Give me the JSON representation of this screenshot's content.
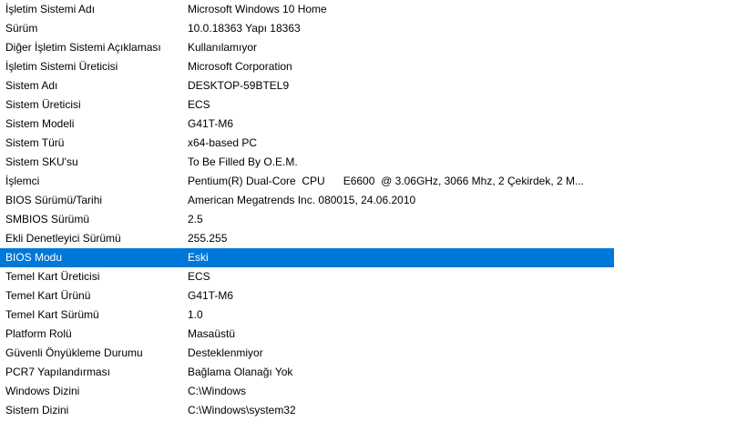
{
  "system_summary": {
    "rows": [
      {
        "item": "İşletim Sistemi Adı",
        "value": "Microsoft Windows 10 Home"
      },
      {
        "item": "Sürüm",
        "value": "10.0.18363 Yapı 18363"
      },
      {
        "item": "Diğer İşletim Sistemi Açıklaması",
        "value": "Kullanılamıyor"
      },
      {
        "item": "İşletim Sistemi Üreticisi",
        "value": "Microsoft Corporation"
      },
      {
        "item": "Sistem Adı",
        "value": "DESKTOP-59BTEL9"
      },
      {
        "item": "Sistem Üreticisi",
        "value": "ECS"
      },
      {
        "item": "Sistem Modeli",
        "value": "G41T-M6"
      },
      {
        "item": "Sistem Türü",
        "value": "x64-based PC"
      },
      {
        "item": "Sistem SKU'su",
        "value": "To Be Filled By O.E.M."
      },
      {
        "item": "İşlemci",
        "value": "Pentium(R) Dual-Core  CPU      E6600  @ 3.06GHz, 3066 Mhz, 2 Çekirdek, 2 M..."
      },
      {
        "item": "BIOS Sürümü/Tarihi",
        "value": "American Megatrends Inc. 080015, 24.06.2010"
      },
      {
        "item": "SMBIOS Sürümü",
        "value": "2.5"
      },
      {
        "item": "Ekli Denetleyici Sürümü",
        "value": "255.255"
      },
      {
        "item": "BIOS Modu",
        "value": "Eski"
      },
      {
        "item": "Temel Kart Üreticisi",
        "value": "ECS"
      },
      {
        "item": "Temel Kart Ürünü",
        "value": "G41T-M6"
      },
      {
        "item": "Temel Kart Sürümü",
        "value": "1.0"
      },
      {
        "item": "Platform Rolü",
        "value": "Masaüstü"
      },
      {
        "item": "Güvenli Önyükleme Durumu",
        "value": "Desteklenmiyor"
      },
      {
        "item": "PCR7 Yapılandırması",
        "value": "Bağlama Olanağı Yok"
      },
      {
        "item": "Windows Dizini",
        "value": "C:\\Windows"
      },
      {
        "item": "Sistem Dizini",
        "value": "C:\\Windows\\system32"
      }
    ],
    "selected_item": "BIOS Modu"
  },
  "colors": {
    "selection_background": "#0078d7",
    "selection_text": "#ffffff",
    "text": "#000000",
    "background": "#ffffff"
  }
}
